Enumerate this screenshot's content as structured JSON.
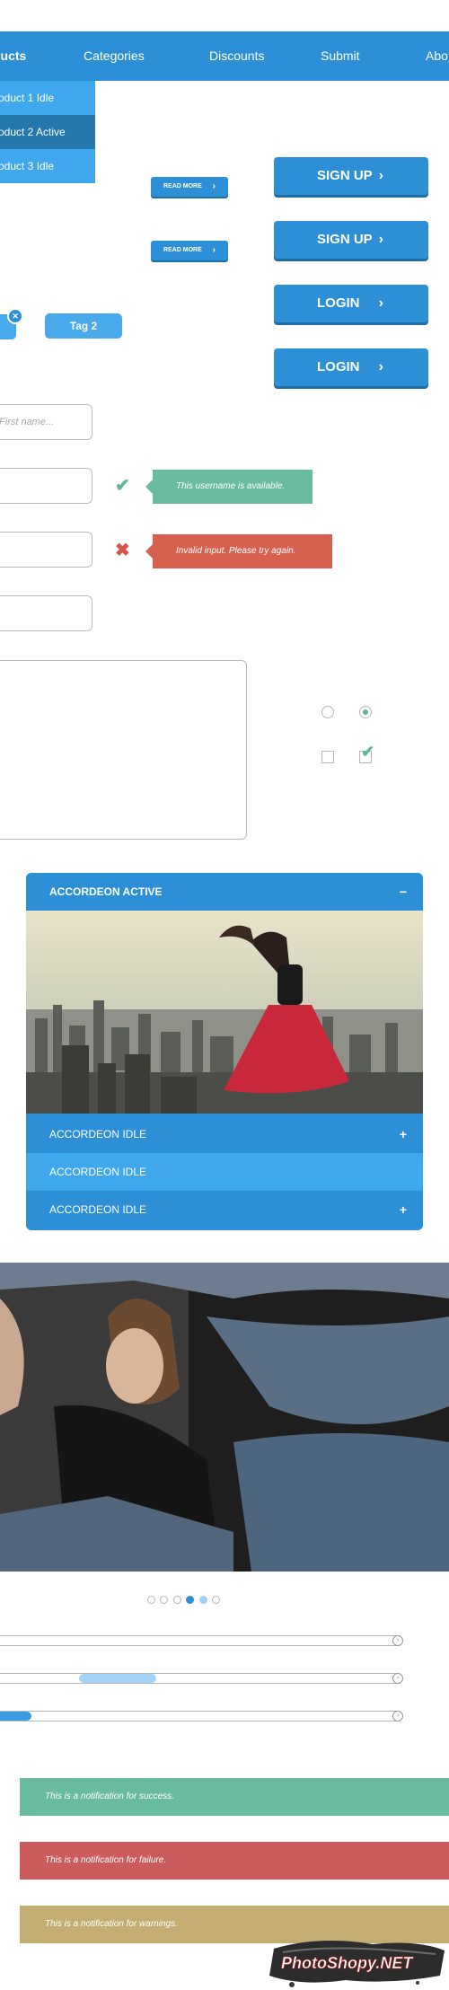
{
  "nav": {
    "items": [
      "ducts",
      "Categories",
      "Discounts",
      "Submit",
      "Abo"
    ]
  },
  "dropdown": {
    "items": [
      "roduct 1 Idle",
      "roduct 2 Active",
      "roduct 3 Idle"
    ]
  },
  "buttons": {
    "read_more": "READ MORE",
    "sign_up": "SIGN UP",
    "login": "LOGIN"
  },
  "tags": {
    "tag_2": "Tag 2"
  },
  "form": {
    "first_name_placeholder": "First name...",
    "success_message": "This username is available.",
    "error_message": "Invalid input. Please try again."
  },
  "accordion": {
    "active_label": "ACCORDEON ACTIVE",
    "idle_label": "ACCORDEON IDLE"
  },
  "notifications": {
    "success": "This is a notification for success.",
    "failure": "This is a notification for failure.",
    "warning": "This is a notification for warnings."
  },
  "watermark": "PhotoShopy.NET",
  "colors": {
    "primary": "#2d8fd5",
    "primary_light": "#3fa7ec",
    "primary_dark": "#2677ad",
    "success": "#6abca0",
    "error": "#d6614f",
    "warning": "#c3ad72"
  }
}
